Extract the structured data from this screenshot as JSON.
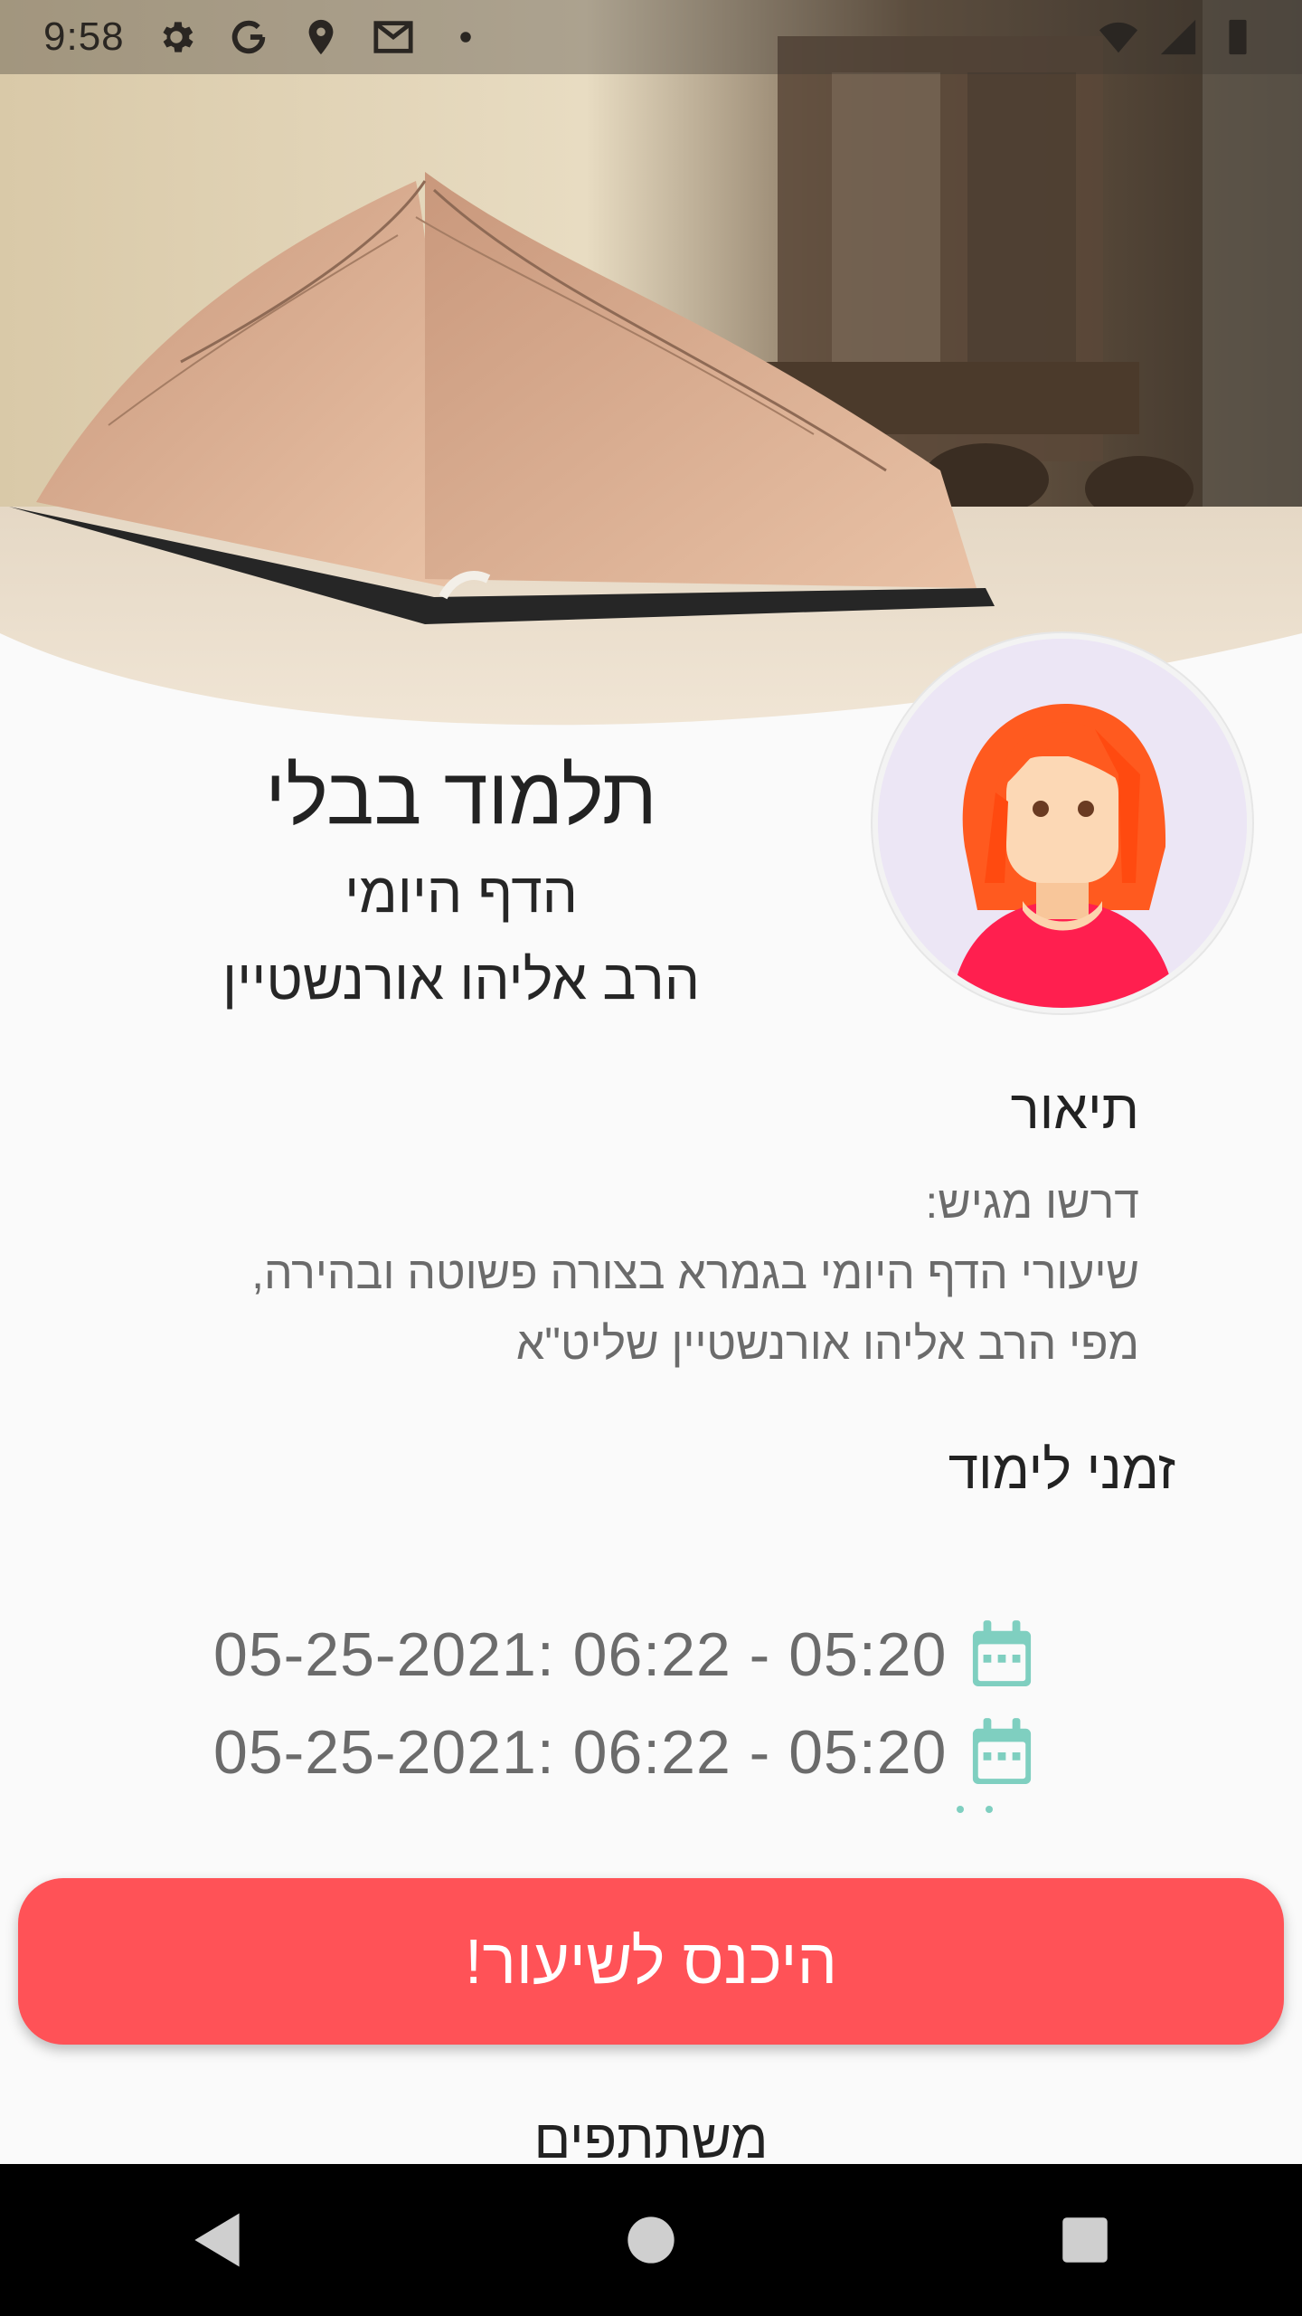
{
  "status_bar": {
    "time": "9:58",
    "icons_left": [
      "settings-icon",
      "google-icon",
      "location-icon",
      "gmail-icon",
      "dot-icon"
    ],
    "icons_right": [
      "wifi-icon",
      "signal-icon",
      "battery-icon"
    ]
  },
  "hero": {
    "image": "open-book-photo"
  },
  "course": {
    "title": "תלמוד בבלי",
    "subtitle": "הדף היומי",
    "teacher": "הרב אליהו אורנשטיין"
  },
  "description": {
    "heading": "תיאור",
    "lines": [
      "דרשו מגיש:",
      "שיעורי הדף היומי בגמרא בצורה פשוטה ובהירה,",
      "מפי הרב אליהו אורנשטיין שליט\"א"
    ]
  },
  "schedule": {
    "heading": "זמני לימוד",
    "items": [
      {
        "text": "05-25-2021: 06:22 - 05:20"
      },
      {
        "text": "05-25-2021: 06:22 - 05:20"
      }
    ],
    "icon_color": "#7fcfc0"
  },
  "enter_button": {
    "label": "היכנס לשיעור!",
    "color": "#ff5257"
  },
  "participants": {
    "heading": "משתתפים"
  }
}
